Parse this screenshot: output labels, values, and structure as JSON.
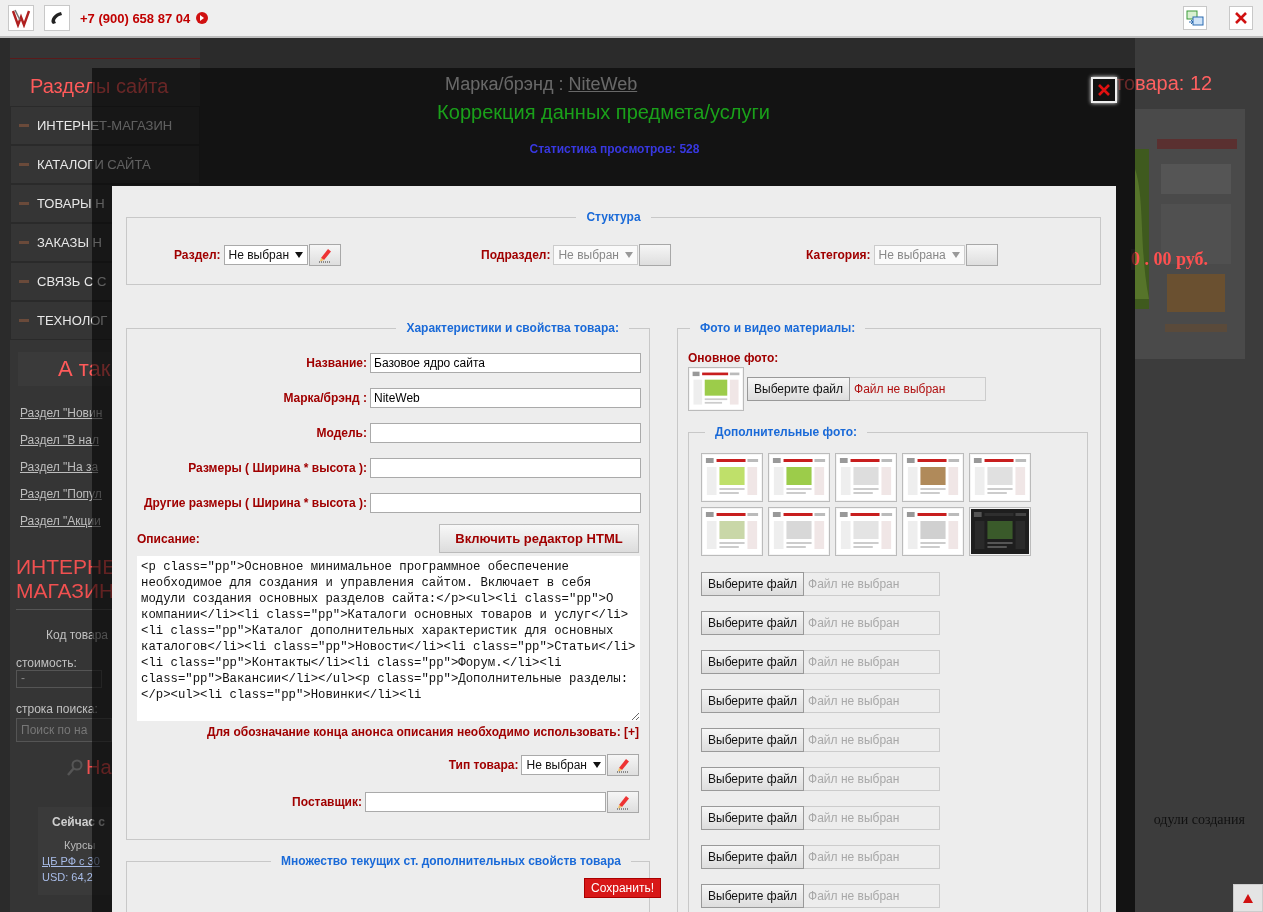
{
  "top_bar": {
    "phone": "+7 (900) 658 87 04"
  },
  "page": {
    "sidebar_title": "Разделы сайта",
    "sidebar_items": [
      {
        "label": "ИНТЕРНЕТ-МАГАЗИН"
      },
      {
        "label": "КАТАЛОГИ САЙТА"
      },
      {
        "label": "ТОВАРЫ Н"
      },
      {
        "label": "ЗАКАЗЫ Н"
      },
      {
        "label": "СВЯЗЬ С С"
      },
      {
        "label": "ТЕХНОЛОГ"
      }
    ],
    "also_heading": "А так",
    "links": [
      "Раздел \"Новин",
      "Раздел \"В нал",
      "Раздел \"На за",
      "Раздел \"Попул",
      "Раздел \"Акции"
    ],
    "shop_heading": [
      "ИНТЕРНЕ",
      "МАГАЗИН"
    ],
    "code_label": "Код товара",
    "price_label": "стоимость:",
    "price_select": "-",
    "search_label": "строка поиска:",
    "search_placeholder": "Поиск по на",
    "search_button": "На",
    "now_heading": "Сейчас с",
    "rates_label": "Курсы",
    "rates_link": "ЦБ РФ с 30",
    "usd": "USD: 64,2",
    "brand_label": "Марка/брэнд :",
    "brand_value": "NiteWeb",
    "count": "товара: 12",
    "preview": {
      "kind": "picture"
    },
    "price": "0 . 00 руб.",
    "text_fragment": "одули создания"
  },
  "modal": {
    "title": "Коррекция данных предмета/услуги",
    "stats": "Статистика просмотров: 528",
    "structure": {
      "legend": "Стуктура",
      "fields": [
        {
          "label": "Раздел:",
          "value": "Не выбран",
          "disabled": false
        },
        {
          "label": "Подраздел:",
          "value": "Не выбран",
          "disabled": true
        },
        {
          "label": "Категория:",
          "value": "Не выбрана",
          "disabled": true
        }
      ]
    },
    "properties": {
      "legend": "Характеристики и свойства товара:",
      "fields": [
        {
          "label": "Название:",
          "value": "Базовое ядро сайта"
        },
        {
          "label": "Марка/брэнд :",
          "value": "NiteWeb"
        },
        {
          "label": "Модель:"
        },
        {
          "label": "Размеры ( Ширина * высота ):"
        },
        {
          "label": "Другие размеры ( Ширина * высота ):"
        }
      ],
      "description_label": "Описание:",
      "html_editor_button": "Включить редактор HTML",
      "description": "<p class=\"pp\">Основное минимальное программное обеспечение необходимое для создания и управления сайтом. Включает в себя модули создания основных разделов сайта:</p><ul><li class=\"pp\">О компании</li><li class=\"pp\">Каталоги основных товаров и услуг</li><li class=\"pp\">Каталог дополнительных характеристик для основных каталогов</li><li class=\"pp\">Новости</li><li class=\"pp\">Статьи</li><li class=\"pp\">Контакты</li><li class=\"pp\">Форум.</li><li class=\"pp\">Вакансии</li></ul><p class=\"pp\">Дополнительные разделы:</p><ul><li class=\"pp\">Новинки</li><li",
      "note": "Для обозначание конца анонса описания необходимо использовать: [+]",
      "type_label": "Тип товара:",
      "type_value": "Не выбран",
      "supplier_label": "Поставщик:"
    },
    "extra_properties": {
      "legend": "Множество текущих ст. дополнительных свойств товара",
      "save_button": "Сохранить!"
    },
    "media": {
      "legend": "Фото и видео материалы:",
      "main_photo_label": "Оновное фото:",
      "main_photo": {
        "kind": "picture"
      },
      "main_file": {
        "button": "Выберите файл",
        "status": "Файл не выбран",
        "disabled": false
      },
      "extra_legend": "Дополнительные фото:",
      "extra_photos": [
        {
          "kind": "picture"
        },
        {
          "kind": "picture"
        },
        {
          "kind": "picture"
        },
        {
          "kind": "picture"
        },
        {
          "kind": "picture"
        },
        {
          "kind": "picture"
        },
        {
          "kind": "picture"
        },
        {
          "kind": "picture"
        },
        {
          "kind": "picture"
        },
        {
          "kind": "picture"
        }
      ],
      "extra_files": [
        {
          "button": "Выберите файл",
          "status": "Файл не выбран",
          "disabled": true
        },
        {
          "button": "Выберите файл",
          "status": "Файл не выбран",
          "disabled": true
        },
        {
          "button": "Выберите файл",
          "status": "Файл не выбран",
          "disabled": true
        },
        {
          "button": "Выберите файл",
          "status": "Файл не выбран",
          "disabled": true
        },
        {
          "button": "Выберите файл",
          "status": "Файл не выбран",
          "disabled": true
        },
        {
          "button": "Выберите файл",
          "status": "Файл не выбран",
          "disabled": true
        },
        {
          "button": "Выберите файл",
          "status": "Файл не выбран",
          "disabled": true
        },
        {
          "button": "Выберите файл",
          "status": "Файл не выбран",
          "disabled": true
        },
        {
          "button": "Выберите файл",
          "status": "Файл не выбран",
          "disabled": true
        }
      ]
    }
  }
}
